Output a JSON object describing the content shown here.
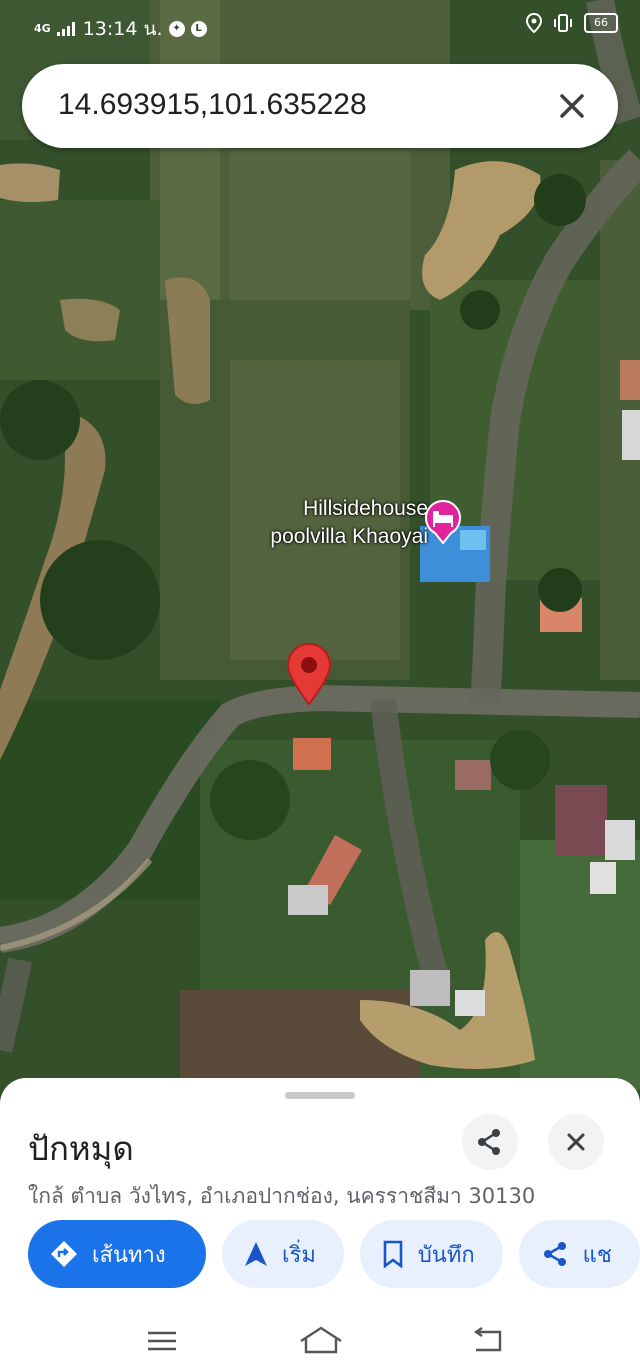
{
  "status_bar": {
    "network": "4G",
    "time": "13:14 น.",
    "battery": "66"
  },
  "search": {
    "query": "14.693915,101.635228"
  },
  "map": {
    "poi_label_line1": "Hillsidehouse",
    "poi_label_line2": "poolvilla Khaoyai",
    "poi_icon": "hotel-bed-icon",
    "pin_color": "#e53935",
    "poi_color": "#e0249c"
  },
  "sheet": {
    "title": "ปักหมุด",
    "address": "ใกล้ ตำบล วังไทร, อำเภอปากช่อง, นครราชสีมา 30130",
    "actions": [
      {
        "label": "เส้นทาง",
        "icon": "directions-icon"
      },
      {
        "label": "เริ่ม",
        "icon": "navigation-arrow-icon"
      },
      {
        "label": "บันทึก",
        "icon": "bookmark-icon"
      },
      {
        "label": "แช",
        "icon": "share-icon"
      }
    ]
  },
  "colors": {
    "accent": "#1a73e8",
    "chip_bg": "#e8f0fe"
  }
}
